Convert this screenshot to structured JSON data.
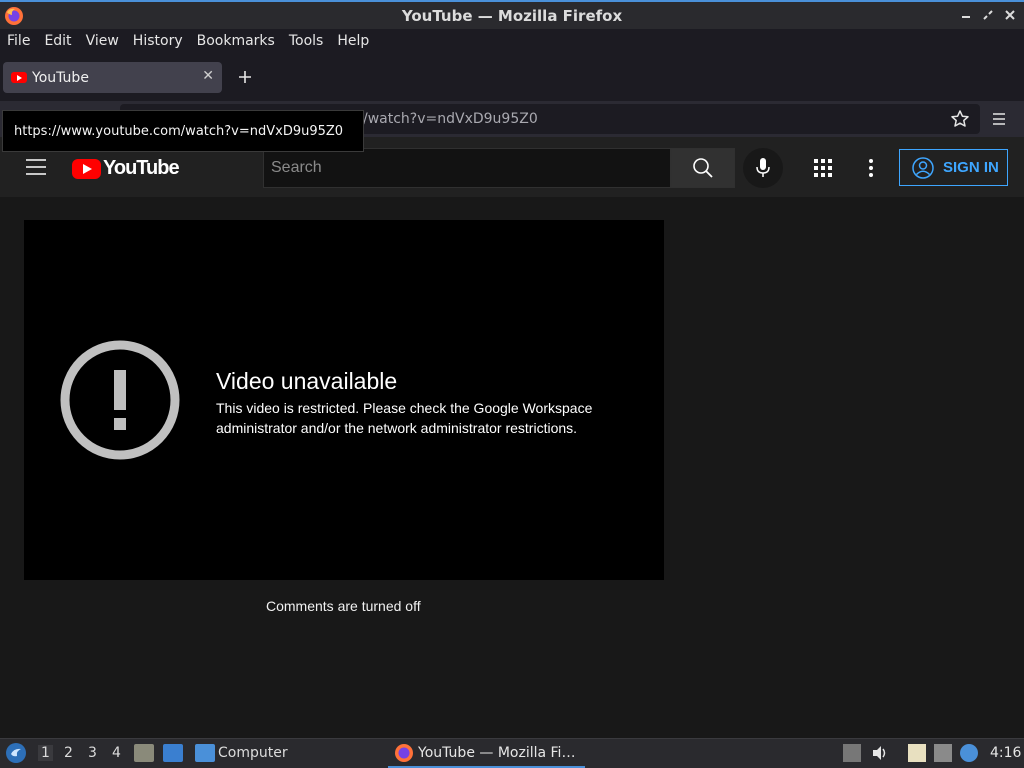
{
  "window": {
    "title": "YouTube — Mozilla Firefox"
  },
  "menubar": {
    "items": [
      "File",
      "Edit",
      "View",
      "History",
      "Bookmarks",
      "Tools",
      "Help"
    ]
  },
  "tabs": [
    {
      "label": "YouTube",
      "active": true
    }
  ],
  "urlbar": {
    "visible_text": "/watch?v=ndVxD9u95Z0"
  },
  "tooltip": {
    "text": "https://www.youtube.com/watch?v=ndVxD9u95Z0"
  },
  "youtube": {
    "logo_text": "YouTube",
    "search_placeholder": "Search",
    "sign_in_label": "SIGN IN",
    "error_title": "Video unavailable",
    "error_message": "This video is restricted. Please check the Google Workspace administrator and/or the network administrator restrictions.",
    "comments_status": "Comments are turned off"
  },
  "taskbar": {
    "workspaces": [
      "1",
      "2",
      "3",
      "4"
    ],
    "folder_label": "Computer",
    "task_label": "YouTube — Mozilla Fi…",
    "clock": "4:16"
  },
  "colors": {
    "accent": "#4a90d9",
    "youtube_red": "#ff0000",
    "sign_in_blue": "#3ea6ff"
  }
}
